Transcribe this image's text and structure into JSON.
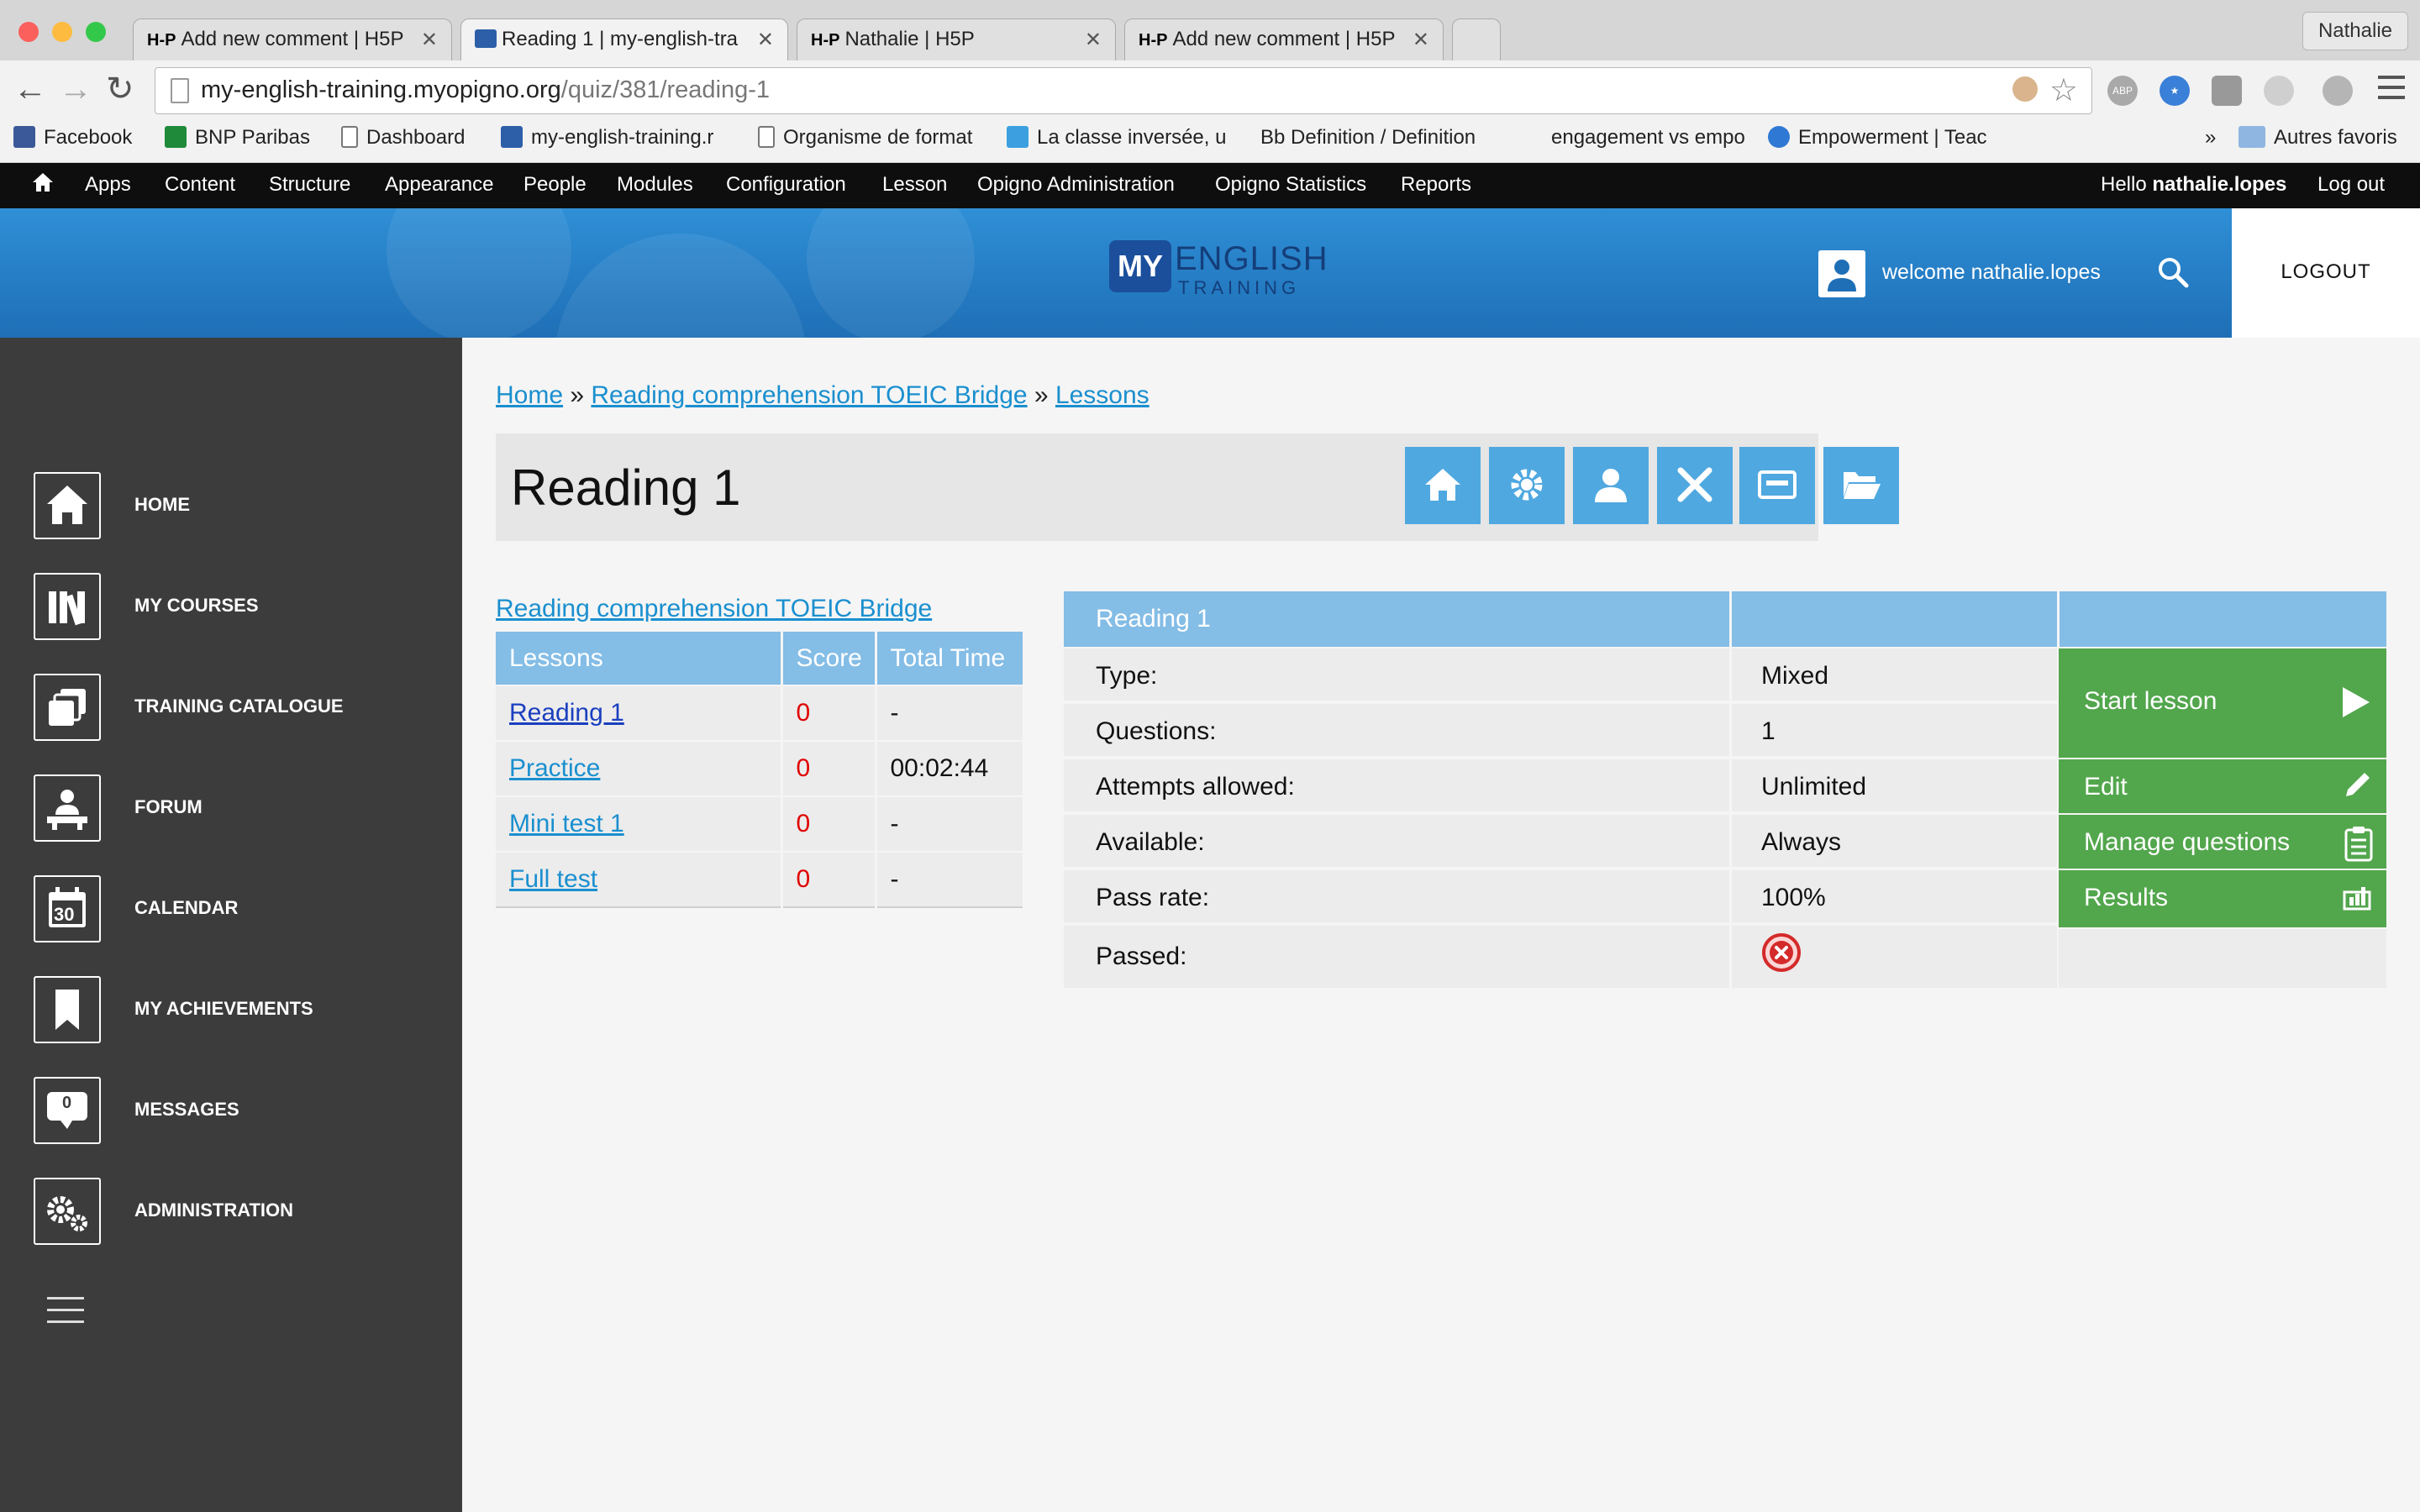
{
  "browser": {
    "tabs": [
      {
        "label": "Add new comment | H5P",
        "icon": "h5p-icon"
      },
      {
        "label": "Reading 1 | my-english-tra",
        "icon": "site-favicon"
      },
      {
        "label": "Nathalie | H5P",
        "icon": "h5p-icon"
      },
      {
        "label": "Add new comment | H5P",
        "icon": "h5p-icon"
      }
    ],
    "tab_icon_text": "H-P",
    "profile_name": "Nathalie",
    "url_host": "my-english-training.myopigno.org",
    "url_path": "/quiz/381/reading-1",
    "bookmarks": [
      {
        "label": "Facebook",
        "icon_color": "#3b5998"
      },
      {
        "label": "BNP Paribas",
        "icon_color": "#1f8a3a"
      },
      {
        "label": "Dashboard",
        "icon_color": "#ffffff"
      },
      {
        "label": "my-english-training.r",
        "icon_color": "#2d5fa8"
      },
      {
        "label": "Organisme de format",
        "icon_color": "#ffffff"
      },
      {
        "label": "La classe inversée, u",
        "icon_color": "#3b9fe0"
      },
      {
        "label": "Bb Definition / Definition",
        "icon_color": "#f2f2f2"
      },
      {
        "label": "engagement vs empo",
        "icon_color": "#f2f2f2"
      },
      {
        "label": "Empowerment | Teac",
        "icon_color": "#2f78d4"
      }
    ],
    "bookmarks_more": "»",
    "other_bookmarks": "Autres favoris"
  },
  "admin_bar": {
    "items": [
      "Apps",
      "Content",
      "Structure",
      "Appearance",
      "People",
      "Modules",
      "Configuration",
      "Lesson",
      "Opigno Administration",
      "Opigno Statistics",
      "Reports"
    ],
    "hello": "Hello ",
    "username": "nathalie.lopes",
    "logout": "Log out"
  },
  "header": {
    "logo_my": "MY",
    "logo_english": "ENGLISH",
    "logo_training": "TRAINING",
    "welcome": "welcome nathalie.lopes",
    "logout": "LOGOUT"
  },
  "sidebar": {
    "items": [
      {
        "label": "HOME",
        "icon": "home-icon"
      },
      {
        "label": "MY COURSES",
        "icon": "books-icon"
      },
      {
        "label": "TRAINING CATALOGUE",
        "icon": "catalogue-icon"
      },
      {
        "label": "FORUM",
        "icon": "forum-icon"
      },
      {
        "label": "CALENDAR",
        "icon": "calendar-icon"
      },
      {
        "label": "MY ACHIEVEMENTS",
        "icon": "bookmark-icon"
      },
      {
        "label": "MESSAGES",
        "icon": "message-icon"
      },
      {
        "label": "ADMINISTRATION",
        "icon": "gears-icon"
      }
    ],
    "calendar_day": "30",
    "messages_count": "0"
  },
  "breadcrumb": {
    "home": "Home",
    "sep": " » ",
    "course": "Reading comprehension TOEIC Bridge",
    "lessons": "Lessons"
  },
  "page_title": "Reading 1",
  "course_link": "Reading comprehension TOEIC Bridge",
  "lessons_table": {
    "headers": [
      "Lessons",
      "Score",
      "Total Time"
    ],
    "rows": [
      {
        "lesson": "Reading 1",
        "score": "0",
        "time": "-"
      },
      {
        "lesson": "Practice",
        "score": "0",
        "time": "00:02:44"
      },
      {
        "lesson": "Mini test 1",
        "score": "0",
        "time": "-"
      },
      {
        "lesson": "Full test",
        "score": "0",
        "time": "-"
      }
    ]
  },
  "quiz_info": {
    "header": "Reading 1",
    "rows": [
      {
        "label": "Type:",
        "value": "Mixed"
      },
      {
        "label": "Questions:",
        "value": "1"
      },
      {
        "label": "Attempts allowed:",
        "value": "Unlimited"
      },
      {
        "label": "Available:",
        "value": "Always"
      },
      {
        "label": "Pass rate:",
        "value": "100%"
      },
      {
        "label": "Passed:",
        "value": ""
      }
    ],
    "passed_status": "failed-icon",
    "actions": [
      {
        "label": "Start lesson",
        "icon": "play-icon"
      },
      {
        "label": "Edit",
        "icon": "pencil-icon"
      },
      {
        "label": "Manage questions",
        "icon": "clipboard-icon"
      },
      {
        "label": "Results",
        "icon": "results-icon"
      }
    ]
  },
  "colors": {
    "accent_blue": "#4fa8e0",
    "table_header": "#84bde6",
    "action_green": "#52a64c",
    "sidebar_bg": "#3c3c3c",
    "link": "#1a8fcf",
    "score_red": "#e00000"
  }
}
